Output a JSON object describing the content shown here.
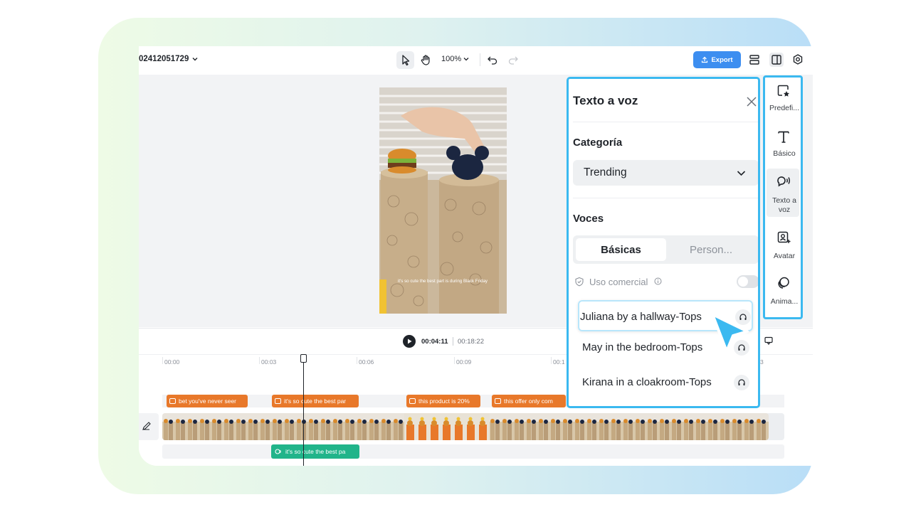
{
  "project": {
    "name": "02412051729"
  },
  "toolbar": {
    "zoom": "100%",
    "export_label": "Export"
  },
  "player": {
    "current_time": "00:04:11",
    "total_time": "00:18:22",
    "subtitle_preview": "it's so cute the best part is during Black Friday"
  },
  "timeline": {
    "ticks": [
      "00:00",
      "00:03",
      "00:06",
      "00:09",
      "00:1",
      "3"
    ],
    "subtitles": [
      "bet you've never seer",
      "it's so cute the best par",
      "this product is 20%",
      "this offer only com"
    ],
    "audio_clip": "it's so cute the best pa"
  },
  "tts_panel": {
    "title": "Texto a voz",
    "category_label": "Categoría",
    "category_value": "Trending",
    "voices_label": "Voces",
    "tabs": [
      "Básicas",
      "Person..."
    ],
    "commercial_label": "Uso comercial",
    "voices": [
      {
        "name": "Juliana by a hallway-Tops"
      },
      {
        "name": "May in the bedroom-Tops"
      },
      {
        "name": "Kirana in a cloakroom-Tops"
      }
    ]
  },
  "rail": {
    "items": [
      {
        "label": "Predefi...",
        "icon": "preset-icon"
      },
      {
        "label": "Básico",
        "icon": "text-icon"
      },
      {
        "label": "Texto a voz",
        "icon": "speech-icon"
      },
      {
        "label": "Avatar",
        "icon": "avatar-icon"
      },
      {
        "label": "Anima...",
        "icon": "animation-icon"
      }
    ]
  },
  "colors": {
    "accent": "#3bb9f0",
    "export": "#3d8ef0",
    "subtitle_clip": "#e8782a",
    "audio_clip": "#21b48a"
  }
}
